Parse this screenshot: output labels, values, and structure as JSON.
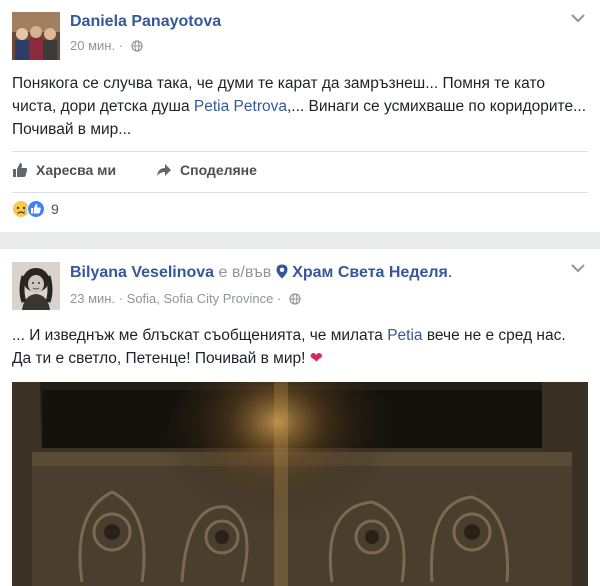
{
  "post1": {
    "author": "Daniela Panayotova",
    "time": "20 мин.",
    "separator": "·",
    "text_a": "Понякога се случва така, че думи те карат да замръзнеш... Помня те като чиста, дори детска душа ",
    "mention": "Petia Petrova",
    "text_b": ",... Винаги се усмихваше по коридорите... Почивай в мир...",
    "like_label": "Харесва ми",
    "share_label": "Споделяне",
    "reaction_count": "9"
  },
  "post2": {
    "author": "Bilyana Veselinova",
    "is_at": "е в/във",
    "place": "Храм Света Неделя",
    "place_end": ".",
    "time": "23 мин.",
    "separator": "·",
    "location": "Sofia, Sofia City Province",
    "text_a": "... И изведнъж ме блъскат съобщенията, че милата ",
    "mention": "Petia",
    "text_b": " вече не е сред нас. Да ти е светло, Петенце! Почивай в мир! ",
    "heart": "❤"
  },
  "icons": {
    "globe": "globe-icon",
    "chevron": "chevron-down-icon",
    "like": "thumbs-up-icon",
    "share": "share-arrow-icon",
    "sad": "sad-reaction-icon",
    "location": "location-pin-icon"
  },
  "colors": {
    "link": "#365899",
    "meta": "#90949c",
    "like_reaction": "#4080ff",
    "heart": "#e0245e"
  }
}
